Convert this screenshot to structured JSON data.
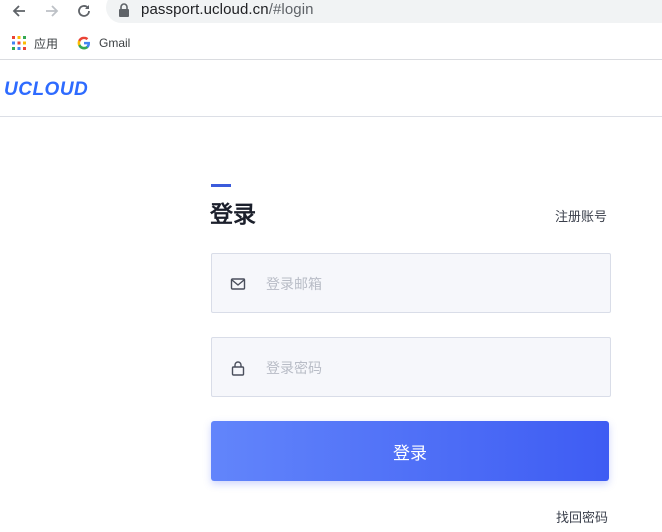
{
  "browser": {
    "url_host": "passport.ucloud.cn",
    "url_path": "/#login",
    "bookmarks": [
      {
        "label": "应用",
        "icon": "apps-grid-icon"
      },
      {
        "label": "Gmail",
        "icon": "google-g-icon"
      }
    ]
  },
  "site": {
    "logo": "UCLOUD",
    "brand_color": "#2e6bff"
  },
  "login": {
    "title": "登录",
    "register_link": "注册账号",
    "email_placeholder": "登录邮箱",
    "password_placeholder": "登录密码",
    "submit_label": "登录",
    "forgot_link": "找回密码",
    "accent_color": "#3e5cf3"
  }
}
